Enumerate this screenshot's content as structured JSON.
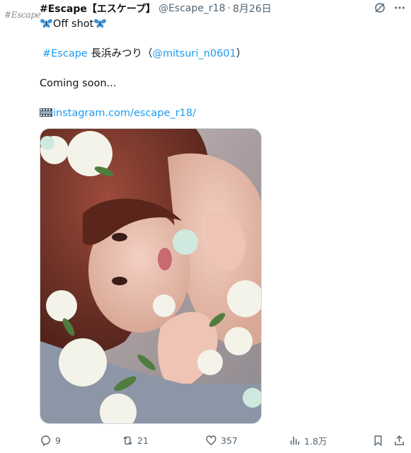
{
  "avatar": {
    "text": "#Escape"
  },
  "header": {
    "display_name": "#Escape【エスケープ】",
    "handle": "@Escape_r18",
    "separator": "·",
    "date": "8月26日"
  },
  "post": {
    "line1_text": "Off shot",
    "line2_hashtag": "#Escape",
    "line2_name": " 長浜みつり（",
    "line2_mention": "@mitsuri_n0601",
    "line2_close": "）",
    "line3_text": "Coming soon...",
    "line4_link": "instagram.com/escape_r18/"
  },
  "actions": {
    "replies": "9",
    "reposts": "21",
    "likes": "357",
    "views": "1.8万"
  },
  "colors": {
    "accent": "#1d9bf0",
    "secondary_text": "#536471",
    "primary_text": "#0f1419"
  },
  "icons": [
    "grok-icon",
    "more-icon",
    "butterfly-emoji",
    "film-frames-emoji",
    "reply-icon",
    "repost-icon",
    "like-icon",
    "views-icon",
    "bookmark-icon",
    "share-icon"
  ]
}
